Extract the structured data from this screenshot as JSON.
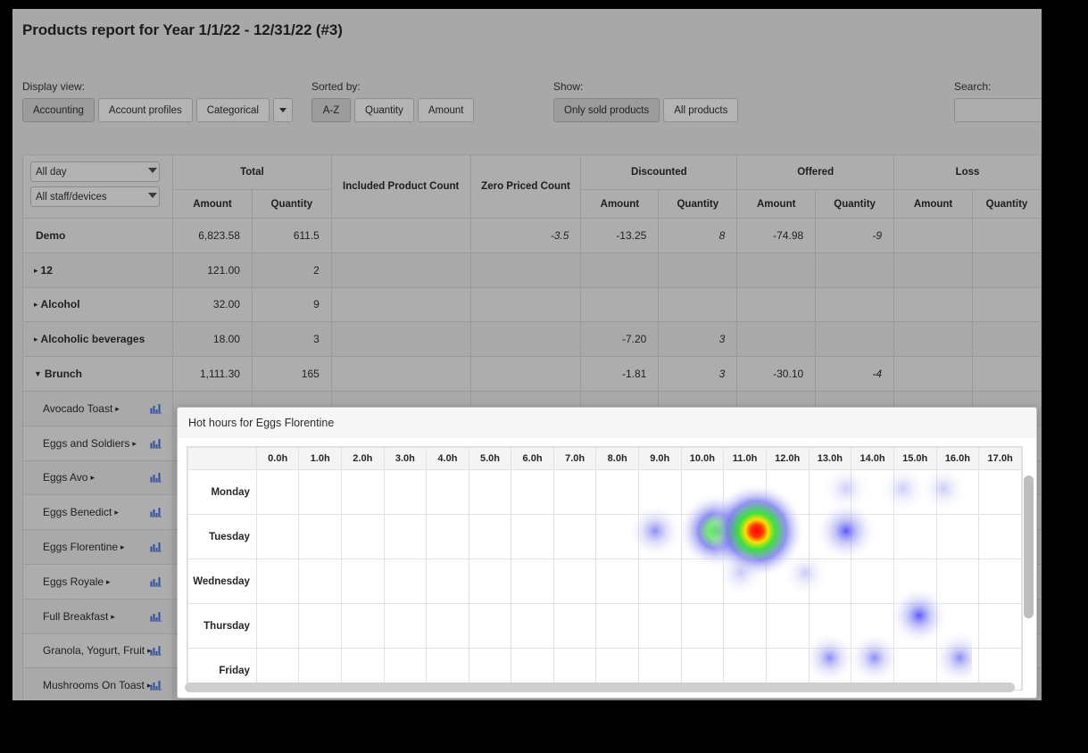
{
  "header": {
    "title": "Products report for Year 1/1/22 - 12/31/22 (#3)"
  },
  "toolbar": {
    "display_view": {
      "label": "Display view:",
      "options": [
        "Accounting",
        "Account profiles",
        "Categorical"
      ],
      "active": "Accounting",
      "more_icon": "chevron-down-icon"
    },
    "sorted_by": {
      "label": "Sorted by:",
      "options": [
        "A-Z",
        "Quantity",
        "Amount"
      ],
      "active": "A-Z"
    },
    "show": {
      "label": "Show:",
      "options": [
        "Only sold products",
        "All products"
      ],
      "active": "Only sold products"
    },
    "search": {
      "label": "Search:",
      "value": "",
      "placeholder": ""
    }
  },
  "filters": {
    "day": {
      "value": "All day",
      "options": [
        "All day"
      ]
    },
    "staff": {
      "value": "All staff/devices",
      "options": [
        "All staff/devices"
      ]
    }
  },
  "table": {
    "group_headers": [
      {
        "label": "",
        "span": 1
      },
      {
        "label": "Total",
        "span": 2
      },
      {
        "label": "Included Product Count",
        "span": 1
      },
      {
        "label": "Zero Priced Count",
        "span": 1
      },
      {
        "label": "Discounted",
        "span": 2
      },
      {
        "label": "Offered",
        "span": 2
      },
      {
        "label": "Loss",
        "span": 2
      }
    ],
    "sub_headers": [
      "Amount",
      "Quantity",
      "Amount",
      "Quantity",
      "Amount",
      "Quantity"
    ],
    "rows": [
      {
        "type": "total",
        "name": "Demo",
        "total_amount": "6,823.58",
        "total_qty": "611.5",
        "included": "",
        "zero_priced": "-3.5",
        "disc_amount": "-13.25",
        "disc_qty": "8",
        "off_amount": "-74.98",
        "off_qty": "-9",
        "loss_amount": "",
        "loss_qty": ""
      },
      {
        "type": "group",
        "expanded": false,
        "name": "12",
        "total_amount": "121.00",
        "total_qty": "2",
        "included": "",
        "zero_priced": "",
        "disc_amount": "",
        "disc_qty": "",
        "off_amount": "",
        "off_qty": "",
        "loss_amount": "",
        "loss_qty": ""
      },
      {
        "type": "group",
        "expanded": false,
        "name": "Alcohol",
        "total_amount": "32.00",
        "total_qty": "9",
        "included": "",
        "zero_priced": "",
        "disc_amount": "",
        "disc_qty": "",
        "off_amount": "",
        "off_qty": "",
        "loss_amount": "",
        "loss_qty": ""
      },
      {
        "type": "group",
        "expanded": false,
        "name": "Alcoholic beverages",
        "total_amount": "18.00",
        "total_qty": "3",
        "included": "",
        "zero_priced": "",
        "disc_amount": "-7.20",
        "disc_qty": "3",
        "off_amount": "",
        "off_qty": "",
        "loss_amount": "",
        "loss_qty": ""
      },
      {
        "type": "group",
        "expanded": true,
        "name": "Brunch",
        "total_amount": "1,111.30",
        "total_qty": "165",
        "included": "",
        "zero_priced": "",
        "disc_amount": "-1.81",
        "disc_qty": "3",
        "off_amount": "-30.10",
        "off_qty": "-4",
        "loss_amount": "",
        "loss_qty": ""
      },
      {
        "type": "product",
        "name": "Avocado Toast",
        "icon": "bar-chart-icon"
      },
      {
        "type": "product",
        "name": "Eggs and Soldiers",
        "icon": "bar-chart-icon"
      },
      {
        "type": "product",
        "name": "Eggs Avo",
        "icon": "bar-chart-icon"
      },
      {
        "type": "product",
        "name": "Eggs Benedict",
        "icon": "bar-chart-icon"
      },
      {
        "type": "product",
        "name": "Eggs Florentine",
        "icon": "bar-chart-icon"
      },
      {
        "type": "product",
        "name": "Eggs Royale",
        "icon": "bar-chart-icon"
      },
      {
        "type": "product",
        "name": "Full Breakfast",
        "icon": "bar-chart-icon"
      },
      {
        "type": "product",
        "name": "Granola, Yogurt, Fruit",
        "icon": "bar-chart-icon"
      },
      {
        "type": "product",
        "name": "Mushrooms On Toast",
        "icon": "bar-chart-icon"
      }
    ]
  },
  "modal": {
    "title": "Hot hours for Eggs Florentine",
    "hours": [
      "0.0h",
      "1.0h",
      "2.0h",
      "3.0h",
      "4.0h",
      "5.0h",
      "6.0h",
      "7.0h",
      "8.0h",
      "9.0h",
      "10.0h",
      "11.0h",
      "12.0h",
      "13.0h",
      "14.0h",
      "15.0h",
      "16.0h",
      "17.0h"
    ],
    "days": [
      "Monday",
      "Tuesday",
      "Wednesday",
      "Thursday",
      "Friday"
    ]
  },
  "chart_data": {
    "type": "heatmap",
    "title": "Hot hours for Eggs Florentine",
    "xlabel": "",
    "ylabel": "",
    "x": [
      "0.0h",
      "1.0h",
      "2.0h",
      "3.0h",
      "4.0h",
      "5.0h",
      "6.0h",
      "7.0h",
      "8.0h",
      "9.0h",
      "10.0h",
      "11.0h",
      "12.0h",
      "13.0h",
      "14.0h",
      "15.0h",
      "16.0h",
      "17.0h"
    ],
    "y": [
      "Monday",
      "Tuesday",
      "Wednesday",
      "Thursday",
      "Friday"
    ],
    "colorscale": [
      "#ffffff",
      "#c8c8f0",
      "#7a7ae8",
      "#30e030",
      "#ffff00",
      "#ff0000"
    ],
    "points": [
      {
        "day": "Monday",
        "hour": 14.2,
        "intensity": 0.12
      },
      {
        "day": "Monday",
        "hour": 15.6,
        "intensity": 0.12
      },
      {
        "day": "Monday",
        "hour": 16.6,
        "intensity": 0.1
      },
      {
        "day": "Tuesday",
        "hour": 9.5,
        "intensity": 0.22
      },
      {
        "day": "Tuesday",
        "hour": 11.0,
        "intensity": 0.62
      },
      {
        "day": "Tuesday",
        "hour": 12.0,
        "intensity": 1.0
      },
      {
        "day": "Tuesday",
        "hour": 14.2,
        "intensity": 0.34
      },
      {
        "day": "Wednesday",
        "hour": 11.6,
        "intensity": 0.1
      },
      {
        "day": "Wednesday",
        "hour": 13.2,
        "intensity": 0.08
      },
      {
        "day": "Thursday",
        "hour": 16.0,
        "intensity": 0.3
      },
      {
        "day": "Friday",
        "hour": 13.8,
        "intensity": 0.18
      },
      {
        "day": "Friday",
        "hour": 14.9,
        "intensity": 0.18
      },
      {
        "day": "Friday",
        "hour": 17.0,
        "intensity": 0.22
      }
    ],
    "grid": true,
    "legend": "none"
  }
}
